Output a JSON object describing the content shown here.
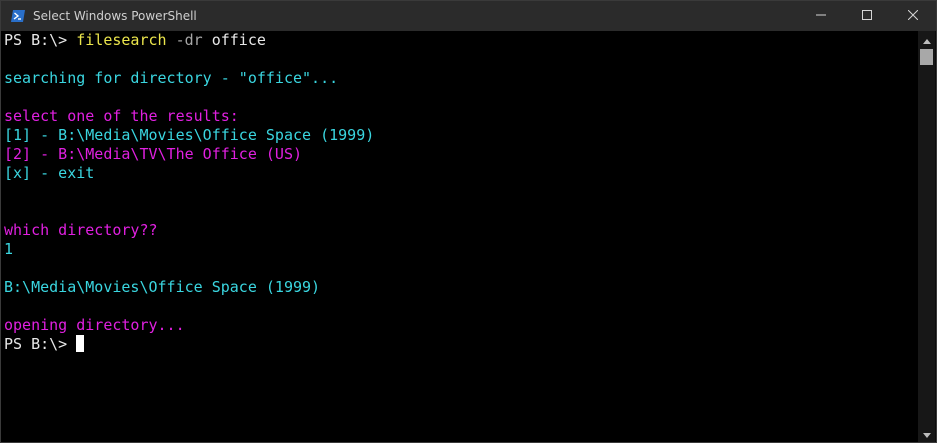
{
  "window": {
    "title": "Select Windows PowerShell",
    "app_icon": "powershell-icon",
    "controls": [
      "minimize-icon",
      "maximize-icon",
      "close-icon"
    ]
  },
  "colors": {
    "cyan": "#3ad6e0",
    "magenta": "#e020e0",
    "command": "#ece64c"
  },
  "console": {
    "prompt": "PS B:\\> ",
    "command": "filesearch",
    "flag": " -dr",
    "argument": " office",
    "searching": "searching for directory - \"office\"...",
    "select_header": "select one of the results:",
    "results": [
      "[1] - B:\\Media\\Movies\\Office Space (1999)",
      "[2] - B:\\Media\\TV\\The Office (US)",
      "[x] - exit"
    ],
    "question": "which directory??",
    "answer": "1",
    "chosen_path": "B:\\Media\\Movies\\Office Space (1999)",
    "opening": "opening directory...",
    "final_prompt": "PS B:\\> "
  }
}
